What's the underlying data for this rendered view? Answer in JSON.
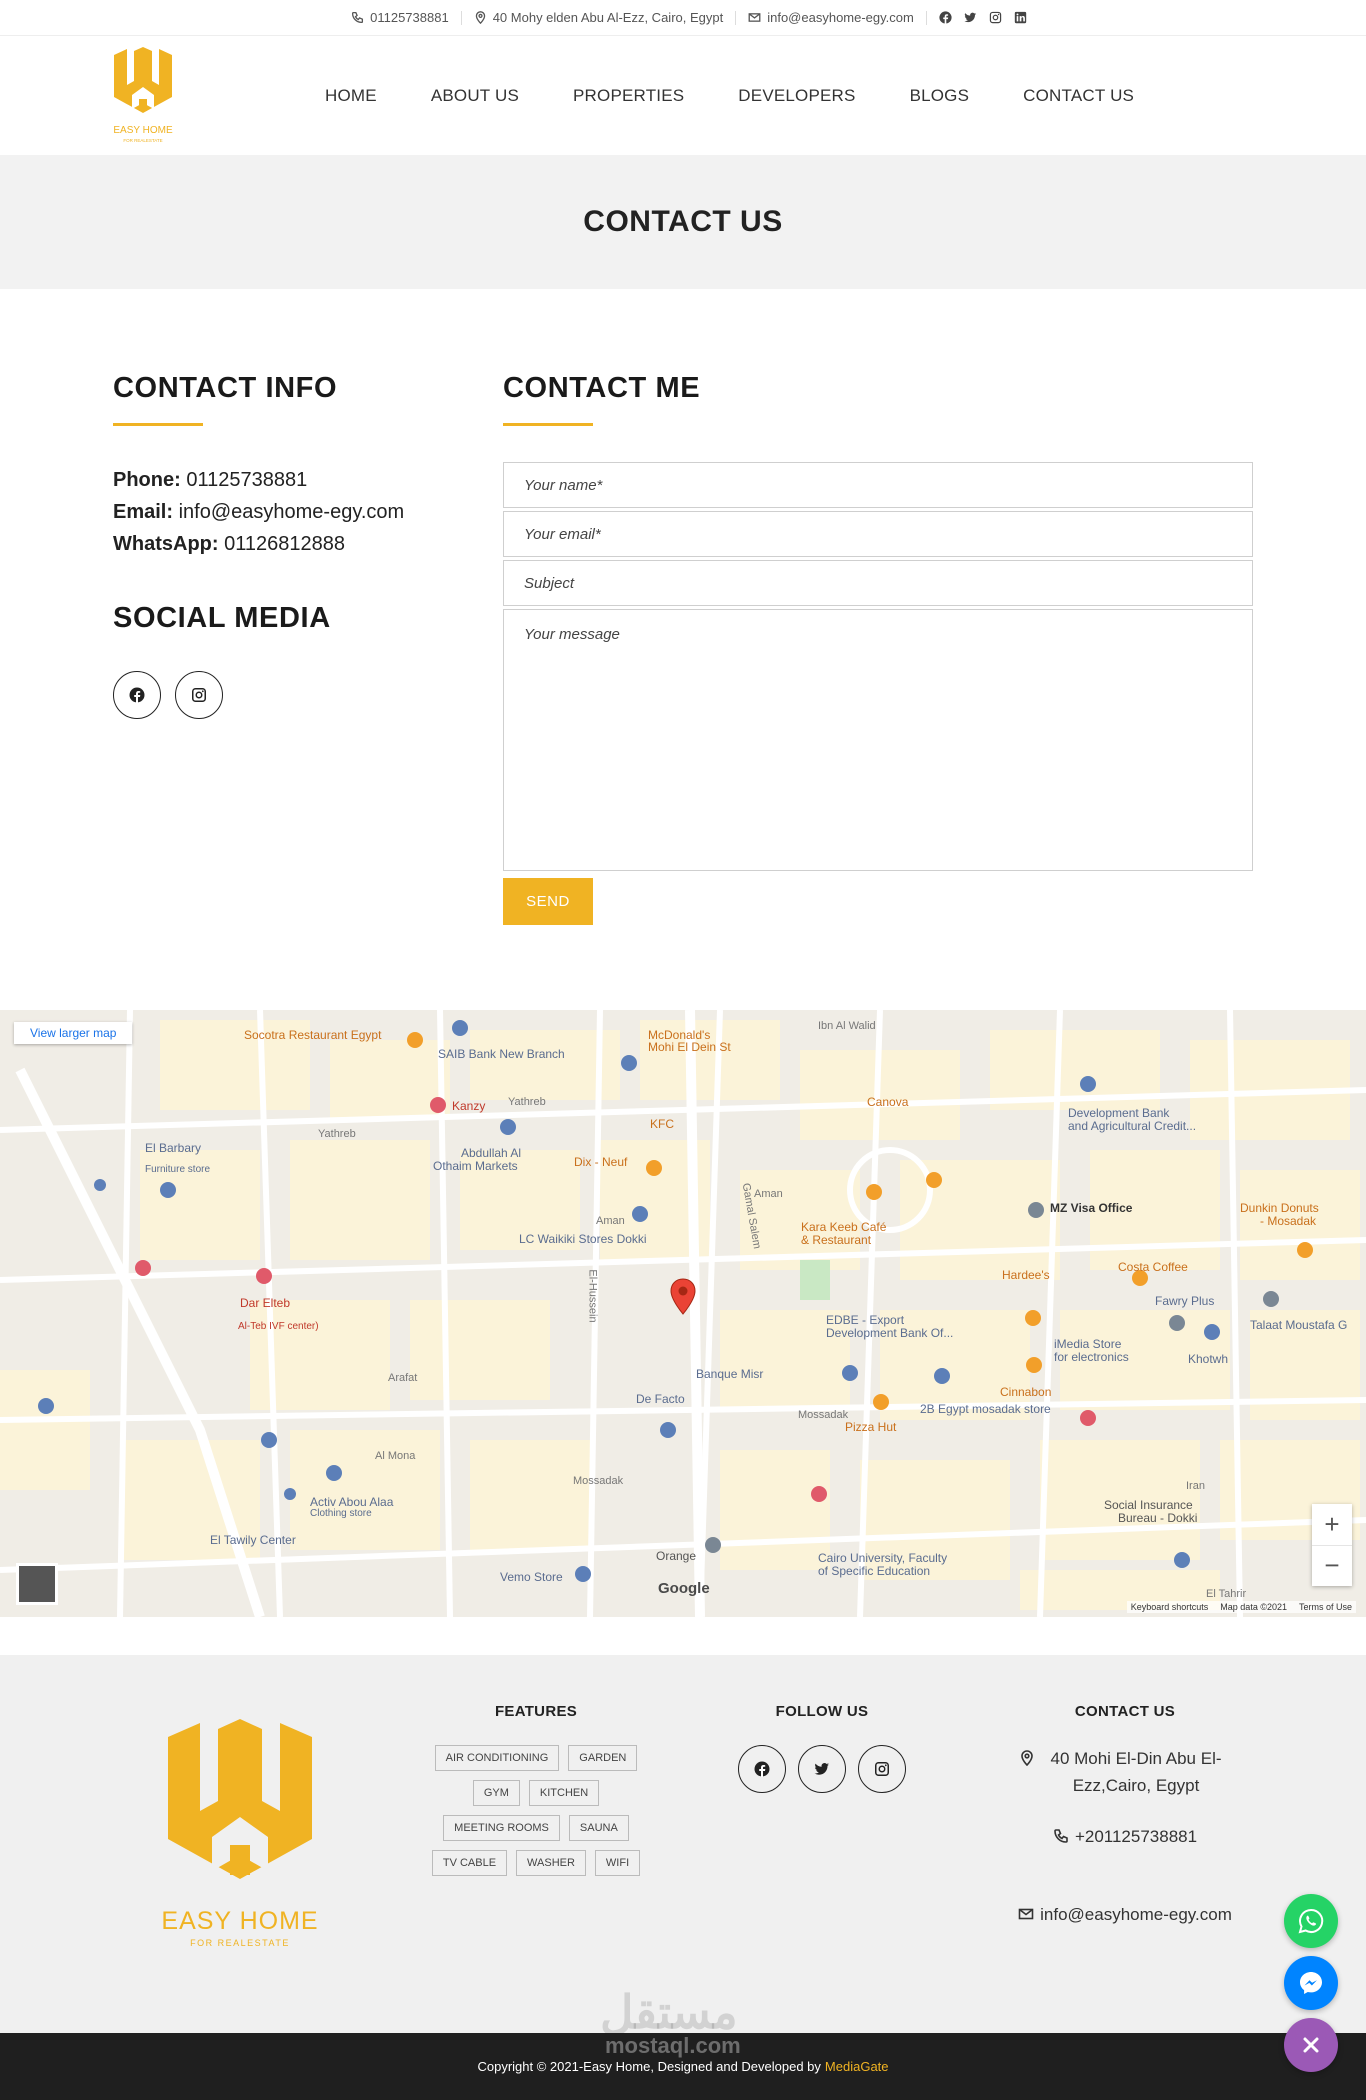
{
  "topbar": {
    "phone": "01125738881",
    "address": "40 Mohy elden Abu Al-Ezz, Cairo, Egypt",
    "email": "info@easyhome-egy.com"
  },
  "logo": {
    "name": "EASY HOME",
    "tagline": "FOR REALESTATE"
  },
  "nav": [
    "HOME",
    "ABOUT US",
    "PROPERTIES",
    "DEVELOPERS",
    "BLOGS",
    "CONTACT US"
  ],
  "page_title": "CONTACT US",
  "contact_info": {
    "title": "CONTACT INFO",
    "phone_label": "Phone:",
    "phone": "01125738881",
    "email_label": "Email:",
    "email": "info@easyhome-egy.com",
    "whatsapp_label": "WhatsApp:",
    "whatsapp": "01126812888",
    "social_title": "SOCIAL MEDIA"
  },
  "contact_form": {
    "title": "CONTACT ME",
    "name_placeholder": "Your name*",
    "email_placeholder": "Your email*",
    "subject_placeholder": "Subject",
    "message_placeholder": "Your message",
    "send_label": "SEND"
  },
  "map": {
    "larger_link": "View larger map",
    "attribution": [
      "Keyboard shortcuts",
      "Map data ©2021",
      "Terms of Use"
    ],
    "google": "Google",
    "labels": {
      "socotra": "Socotra Restaurant Egypt",
      "saib": "SAIB Bank New Branch",
      "mcdonalds": "McDonald's",
      "mcdonalds2": "Mohi El Dein St",
      "kanzy": "Kanzy",
      "abdullah": "Abdullah Al",
      "othaim": "Othaim Markets",
      "kfc": "KFC",
      "dixneuf": "Dix - Neuf",
      "canova": "Canova",
      "devbank": "Development Bank",
      "devbank2": "and Agricultural Credit...",
      "elbarbary": "El Barbary",
      "furniture": "Furniture store",
      "mzvisa": "MZ Visa Office",
      "dunkin": "Dunkin Donuts",
      "dunkin2": "- Mosadak",
      "karakeeb": "Kara Keeb Café",
      "karakeeb2": "& Restaurant",
      "lcwaikiki": "LC Waikiki Stores Dokki",
      "hardees": "Hardee's",
      "costa": "Costa Coffee",
      "fawry": "Fawry Plus",
      "talaat": "Talaat Moustafa G",
      "darelteb": "Dar Elteb",
      "darelteb2": "Al-Teb IVF center)",
      "edbe": "EDBE - Export",
      "edbe2": "Development Bank Of...",
      "imedia": "iMedia Store",
      "imedia2": "for electronics",
      "khotwh": "Khotwh",
      "banquemisr": "Banque Misr",
      "defacto": "De Facto",
      "cinnabon": "Cinnabon",
      "twob": "2B Egypt mosadak store",
      "pizzahut": "Pizza Hut",
      "activ": "Activ Abou Alaa",
      "clothing": "Clothing store",
      "tawily": "El Tawily Center",
      "vemo": "Vemo Store",
      "orange": "Orange",
      "cairouni": "Cairo University, Faculty",
      "cairouni2": "of Specific Education",
      "socialins": "Social Insurance",
      "socialins2": "Bureau - Dokki",
      "mossadak": "Mossadak",
      "yathreb": "Yathreb",
      "aman": "Aman",
      "arafat": "Arafat",
      "almona": "Al Mona",
      "elhussein": "El-Hussein",
      "gamalsalem": "Gamal Salem",
      "ibnalwalid": "Ibn Al Walid",
      "iran": "Iran",
      "eltahrir": "El Tahrir"
    }
  },
  "footer": {
    "features_title": "FEATURES",
    "features": [
      "AIR CONDITIONING",
      "GARDEN",
      "GYM",
      "KITCHEN",
      "MEETING ROOMS",
      "SAUNA",
      "TV CABLE",
      "WASHER",
      "WIFI"
    ],
    "follow_title": "FOLLOW US",
    "contact_title": "CONTACT US",
    "address": "40 Mohi El-Din Abu El-Ezz,Cairo, Egypt",
    "phone": "+201125738881",
    "email": "info@easyhome-egy.com"
  },
  "copyright": {
    "text": "Copyright © 2021-Easy Home, Designed and Developed by",
    "brand": "MediaGate"
  },
  "watermark": {
    "arabic": "مستقل",
    "latin": "mostaql.com"
  },
  "colors": {
    "accent": "#f0b323",
    "dark": "#1f1f1f",
    "whatsapp": "#25d366",
    "messenger": "#0084ff",
    "close": "#9b59b6"
  }
}
